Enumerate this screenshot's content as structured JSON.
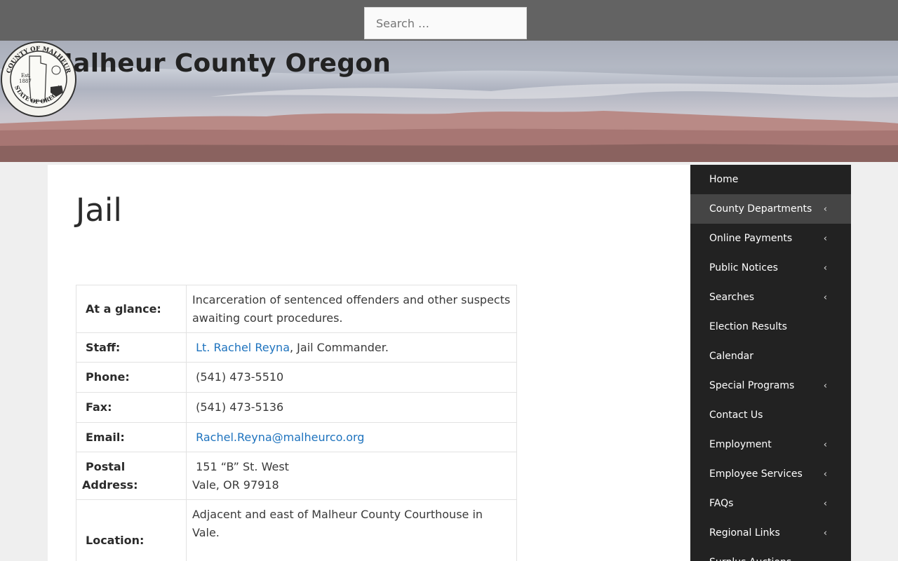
{
  "search": {
    "placeholder": "Search …"
  },
  "site": {
    "title": "Malheur County Oregon"
  },
  "seal": {
    "text_top": "COUNTY OF MALHEUR",
    "text_bottom": "STATE OF OREGON",
    "est": "Est.",
    "year": "1887"
  },
  "page": {
    "title": "Jail"
  },
  "info": {
    "glance_label": "At a glance:",
    "glance_value": " Incarceration of sentenced offenders and other suspects awaiting court procedures.",
    "staff_label": "Staff:",
    "staff_link": "Lt. Rachel Reyna",
    "staff_suffix": ", Jail Commander.",
    "phone_label": "Phone:",
    "phone_value": "(541) 473-5510",
    "fax_label": "Fax:",
    "fax_value": "(541) 473-5136",
    "email_label": "Email:",
    "email_value": "Rachel.Reyna@malheurco.org",
    "postal_label_1": "Postal",
    "postal_label_2": "Address:",
    "postal_line1": "151 “B” St. West",
    "postal_line2": "Vale, OR 97918",
    "location_label": "Location:",
    "location_value": "Adjacent and east of Malheur County Courthouse in Vale."
  },
  "nav": {
    "items": [
      {
        "label": "Home",
        "submenu": false
      },
      {
        "label": "County Departments",
        "submenu": true,
        "active": true
      },
      {
        "label": "Online Payments",
        "submenu": true
      },
      {
        "label": "Public Notices",
        "submenu": true
      },
      {
        "label": "Searches",
        "submenu": true
      },
      {
        "label": "Election Results",
        "submenu": false
      },
      {
        "label": "Calendar",
        "submenu": false
      },
      {
        "label": "Special Programs",
        "submenu": true
      },
      {
        "label": "Contact Us",
        "submenu": false
      },
      {
        "label": "Employment",
        "submenu": true
      },
      {
        "label": "Employee Services",
        "submenu": true
      },
      {
        "label": "FAQs",
        "submenu": true
      },
      {
        "label": "Regional Links",
        "submenu": true
      },
      {
        "label": "Surplus Auctions",
        "submenu": false
      }
    ],
    "chevron": "‹"
  },
  "colors": {
    "topbar": "#636363",
    "sidebar": "#222222",
    "link": "#1e73be"
  }
}
